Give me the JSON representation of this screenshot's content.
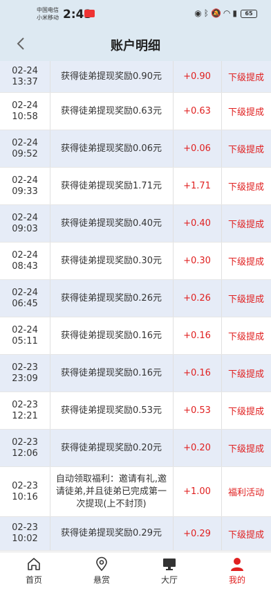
{
  "status_bar": {
    "carrier1": "中国电信",
    "carrier2": "小米移动",
    "time": "2:43",
    "battery": "65"
  },
  "header": {
    "title": "账户明细"
  },
  "records": [
    {
      "date": "02-24",
      "time": "13:37",
      "desc": "获得徒弟提现奖励0.90元",
      "amount": "+0.90",
      "type": "下级提成"
    },
    {
      "date": "02-24",
      "time": "10:58",
      "desc": "获得徒弟提现奖励0.63元",
      "amount": "+0.63",
      "type": "下级提成"
    },
    {
      "date": "02-24",
      "time": "09:52",
      "desc": "获得徒弟提现奖励0.06元",
      "amount": "+0.06",
      "type": "下级提成"
    },
    {
      "date": "02-24",
      "time": "09:33",
      "desc": "获得徒弟提现奖励1.71元",
      "amount": "+1.71",
      "type": "下级提成"
    },
    {
      "date": "02-24",
      "time": "09:03",
      "desc": "获得徒弟提现奖励0.40元",
      "amount": "+0.40",
      "type": "下级提成"
    },
    {
      "date": "02-24",
      "time": "08:43",
      "desc": "获得徒弟提现奖励0.30元",
      "amount": "+0.30",
      "type": "下级提成"
    },
    {
      "date": "02-24",
      "time": "06:45",
      "desc": "获得徒弟提现奖励0.26元",
      "amount": "+0.26",
      "type": "下级提成"
    },
    {
      "date": "02-24",
      "time": "05:11",
      "desc": "获得徒弟提现奖励0.16元",
      "amount": "+0.16",
      "type": "下级提成"
    },
    {
      "date": "02-23",
      "time": "23:09",
      "desc": "获得徒弟提现奖励0.16元",
      "amount": "+0.16",
      "type": "下级提成"
    },
    {
      "date": "02-23",
      "time": "12:21",
      "desc": "获得徒弟提现奖励0.53元",
      "amount": "+0.53",
      "type": "下级提成"
    },
    {
      "date": "02-23",
      "time": "12:06",
      "desc": "获得徒弟提现奖励0.20元",
      "amount": "+0.20",
      "type": "下级提成"
    },
    {
      "date": "02-23",
      "time": "10:16",
      "desc": "自动领取福利：邀请有礼,邀请徒弟,并且徒弟已完成第一次提现(上不封顶)",
      "amount": "+1.00",
      "type": "福利活动"
    },
    {
      "date": "02-23",
      "time": "10:02",
      "desc": "获得徒弟提现奖励0.29元",
      "amount": "+0.29",
      "type": "下级提成"
    }
  ],
  "tabbar": {
    "items": [
      {
        "label": "首页",
        "icon": "home-icon"
      },
      {
        "label": "悬赏",
        "icon": "location-pin-icon"
      },
      {
        "label": "大厅",
        "icon": "monitor-icon"
      },
      {
        "label": "我的",
        "icon": "user-icon"
      }
    ],
    "active_index": 3
  },
  "colors": {
    "header_bg": "#dde9f2",
    "accent_red": "#e02020",
    "row_alt_bg": "#e6ecf7"
  }
}
